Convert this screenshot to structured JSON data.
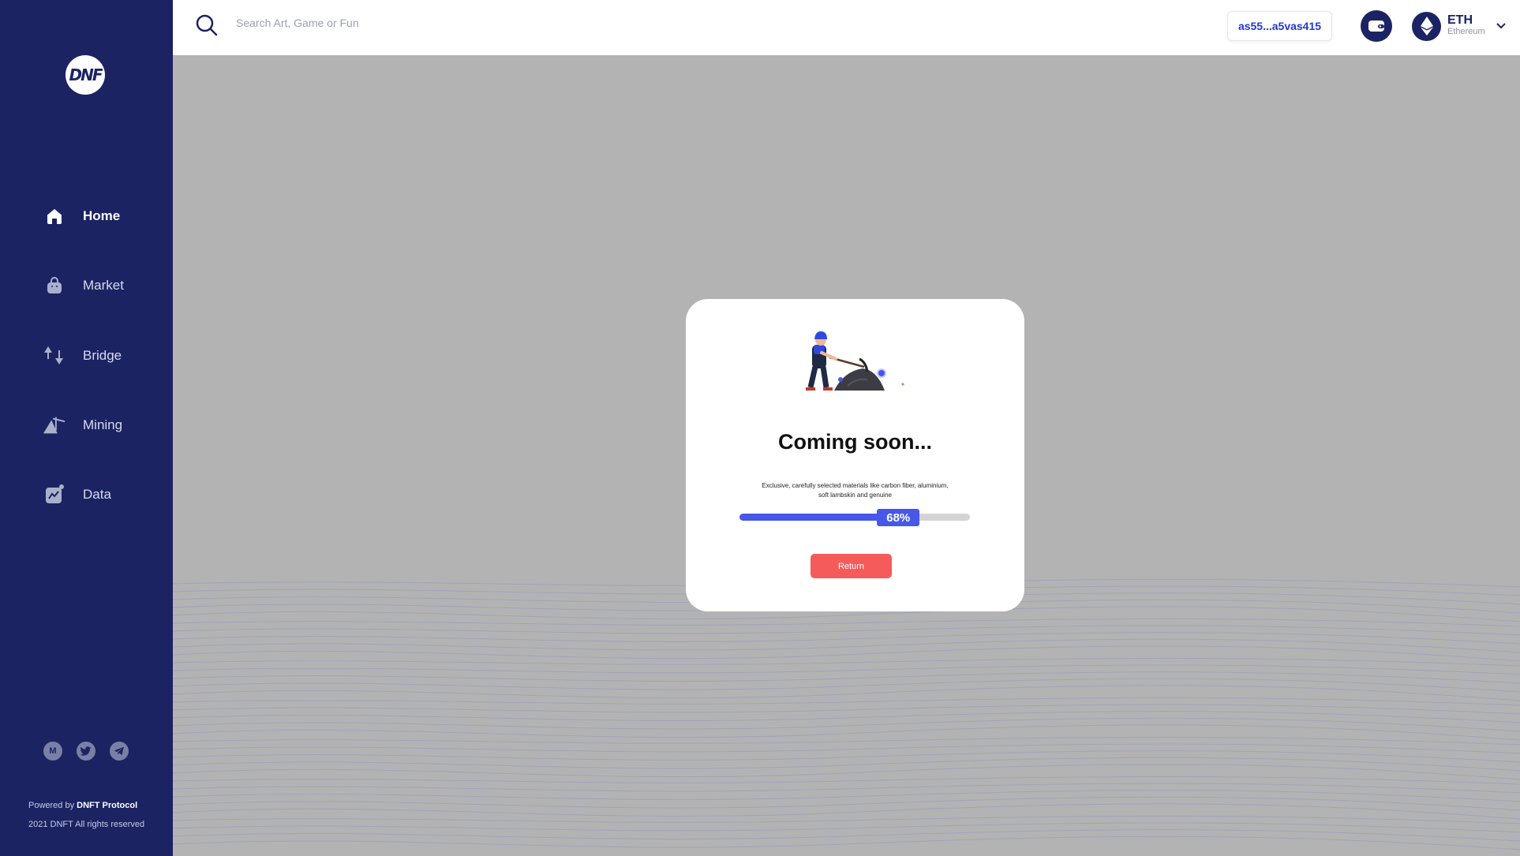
{
  "brand": {
    "logo_text": "DNF"
  },
  "search": {
    "placeholder": "Search Art, Game or Fun"
  },
  "sidebar": {
    "items": [
      {
        "label": "Home",
        "icon": "home-icon",
        "active": true
      },
      {
        "label": "Market",
        "icon": "bag-icon",
        "active": false
      },
      {
        "label": "Bridge",
        "icon": "bridge-icon",
        "active": false
      },
      {
        "label": "Mining",
        "icon": "mining-icon",
        "active": false
      },
      {
        "label": "Data",
        "icon": "chart-icon",
        "active": false
      }
    ],
    "socials": [
      {
        "label": "M",
        "icon": "medium-icon"
      },
      {
        "label": "",
        "icon": "twitter-icon"
      },
      {
        "label": "",
        "icon": "telegram-icon"
      }
    ],
    "footer": {
      "powered_prefix": "Powered by",
      "powered_brand": "DNFT Protocol",
      "copyright": "2021 DNFT All rights reserved"
    }
  },
  "header": {
    "address": "as55...a5vas415",
    "wallet_icon": "wallet-icon",
    "network": {
      "symbol": "ETH",
      "name": "Ethereum",
      "icon": "ethereum-icon"
    }
  },
  "modal": {
    "title": "Coming soon...",
    "description": "Exclusive, carefully selected materials like carbon fiber, aluminium, soft lambskin and genuine",
    "progress": 68,
    "progress_label": "68%",
    "button_label": "Return",
    "illustration": "miner-illustration"
  },
  "colors": {
    "sidebar_bg": "#1b2363",
    "accent": "#4757e8",
    "address_text": "#2236d6",
    "button_red": "#f55b5b",
    "backdrop": "#b3b3b3"
  }
}
